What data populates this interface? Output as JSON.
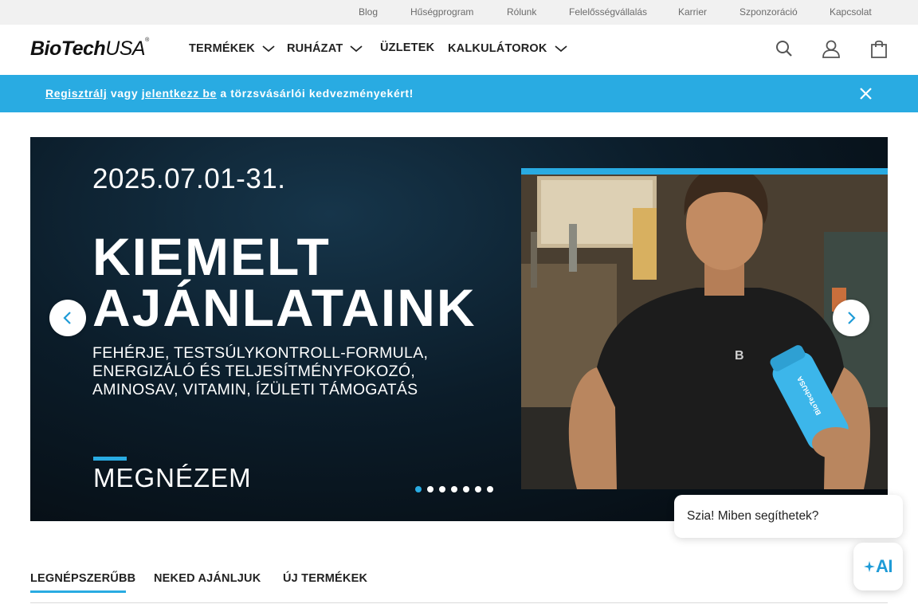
{
  "topbar": {
    "links": [
      "Blog",
      "Hűségprogram",
      "Rólunk",
      "Felelősségvállalás",
      "Karrier",
      "Szponzoráció",
      "Kapcsolat"
    ]
  },
  "header": {
    "logo_main": "BioTech",
    "logo_accent": "USA",
    "nav": [
      {
        "label": "TERMÉKEK",
        "has_dropdown": true
      },
      {
        "label": "RUHÁZAT",
        "has_dropdown": true
      },
      {
        "label": "ÜZLETEK",
        "has_dropdown": false
      },
      {
        "label": "KALKULÁTOROK",
        "has_dropdown": true
      }
    ],
    "icons": [
      "search-icon",
      "user-icon",
      "cart-icon"
    ]
  },
  "promo": {
    "register_link": "Regisztrálj",
    "middle": " vagy ",
    "login_link": "jelentkezz be",
    "tail": " a törzsvásárlói kedvezményekért!"
  },
  "hero": {
    "date": "2025.07.01-31.",
    "title_line1": "KIEMELT",
    "title_line2": "AJÁNLATAINK",
    "sub_line1": "FEHÉRJE, TESTSÚLYKONTROLL-FORMULA,",
    "sub_line2": "ENERGIZÁLÓ ÉS TELJESÍTMÉNYFOKOZÓ,",
    "sub_line3": "AMINOSAV, VITAMIN, ÍZÜLETI TÁMOGATÁS",
    "cta": "MEGNÉZEM",
    "shirt_mark": "B",
    "shaker_text": "BioTechUSA",
    "slide_count": 7,
    "active_slide": 1
  },
  "tabs": [
    {
      "label": "LEGNÉPSZERŰBB",
      "active": true
    },
    {
      "label": "NEKED AJÁNLJUK",
      "active": false
    },
    {
      "label": "ÚJ TERMÉKEK",
      "active": false
    }
  ],
  "chat": {
    "greeting": "Szia! Miben segíthetek?",
    "button_label": "AI"
  },
  "colors": {
    "accent": "#29abe2",
    "topbar_bg": "#f1f1f1",
    "hero_bg": "#0b1c29"
  }
}
